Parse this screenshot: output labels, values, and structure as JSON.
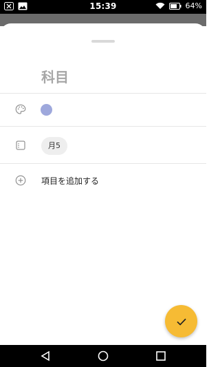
{
  "status_bar": {
    "time": "15:39",
    "battery": "64%"
  },
  "sheet": {
    "title_placeholder": "科目",
    "color_value": "#9ea8dc",
    "day_chip": "月5",
    "add_item_label": "項目を追加する"
  },
  "fab": {
    "icon": "check-icon",
    "color": "#f6bb34"
  },
  "nav": {
    "icons": [
      "back-icon",
      "home-icon",
      "recents-icon"
    ]
  }
}
